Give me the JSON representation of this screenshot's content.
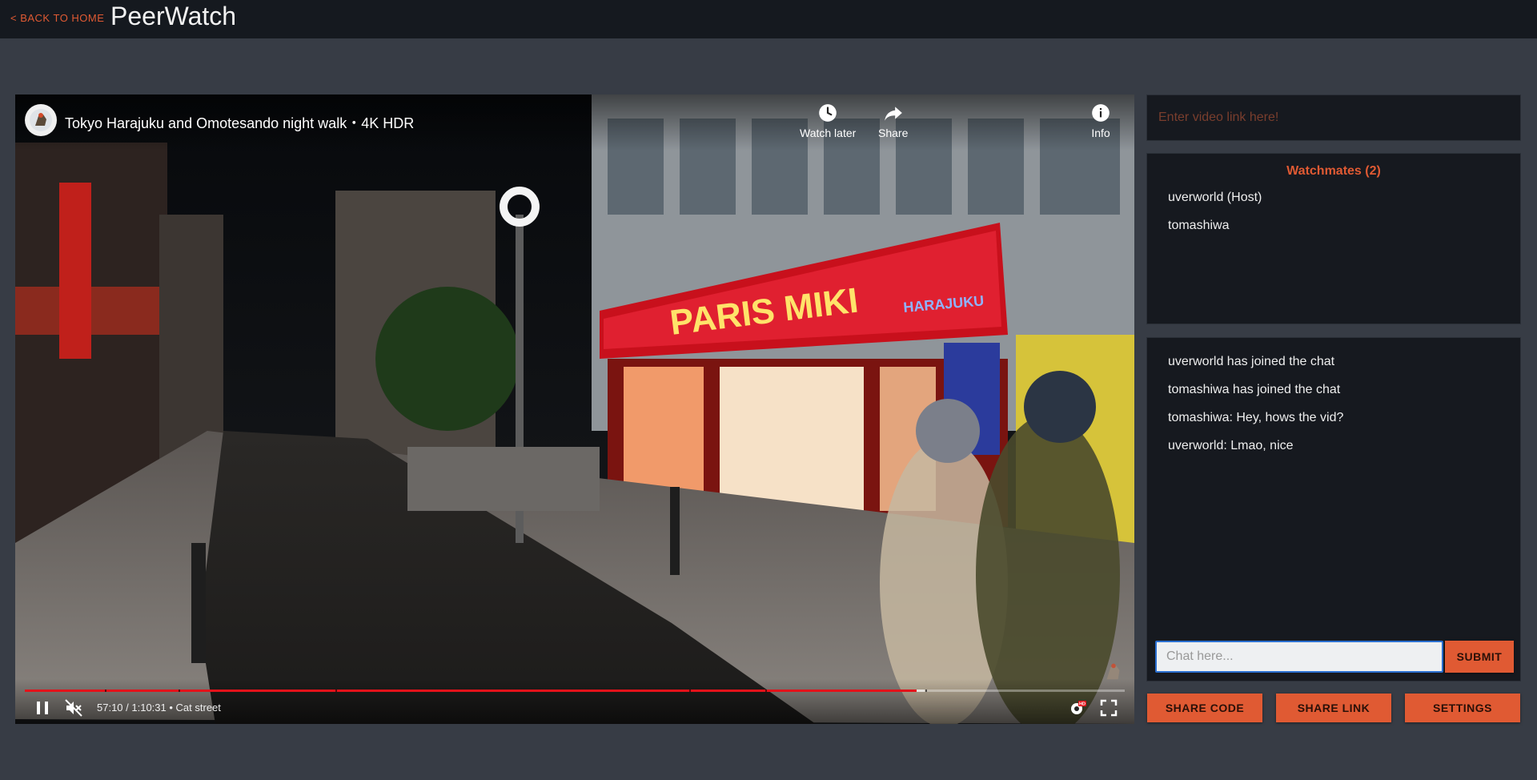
{
  "header": {
    "back_label": "< BACK TO HOME",
    "brand": "PeerWatch"
  },
  "player": {
    "title": "Tokyo Harajuku and Omotesando night walk・4K HDR",
    "actions": {
      "watch_later": "Watch later",
      "share": "Share",
      "info": "Info"
    },
    "time_display": "57:10 / 1:10:31",
    "chapter": "• Cat street",
    "progress_fraction": 0.8106,
    "buffered_fraction": 0.818,
    "hd_badge": "HD",
    "sign_text": "PARIS MIKI",
    "sign_subtext": "HARAJUKU"
  },
  "link_input": {
    "placeholder": "Enter video link here!",
    "value": ""
  },
  "watchmates": {
    "title": "Watchmates (2)",
    "members": [
      "uverworld (Host)",
      "tomashiwa"
    ]
  },
  "chat": {
    "messages": [
      "uverworld has joined the chat",
      "tomashiwa has joined the chat",
      "tomashiwa: Hey, hows the vid?",
      "uverworld: Lmao, nice"
    ],
    "input_placeholder": "Chat here...",
    "submit_label": "SUBMIT"
  },
  "actions": {
    "share_code": "SHARE CODE",
    "share_link": "SHARE LINK",
    "settings": "SETTINGS"
  },
  "colors": {
    "accent": "#e05a33",
    "panel_bg": "#16191f",
    "page_bg": "#373c45",
    "header_bg": "#15191f",
    "progress_red": "#e3121a"
  }
}
